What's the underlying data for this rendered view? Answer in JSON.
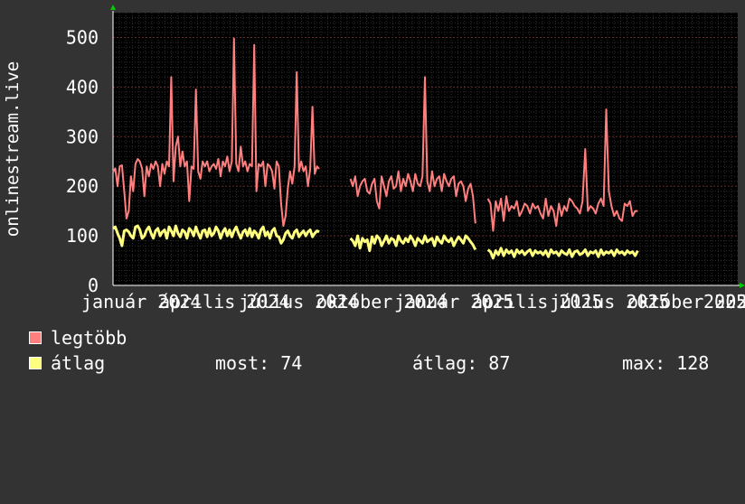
{
  "chart_data": {
    "type": "line",
    "ylabel": "onlinestream.live",
    "ylim": [
      0,
      550
    ],
    "y_ticks": [
      0,
      100,
      200,
      300,
      400,
      500
    ],
    "grid": true,
    "x_tick_labels": [
      "január 2024",
      "április 2024",
      "július 2024",
      "október 2024",
      "január 2025",
      "április 2025",
      "július 2025",
      "október 2025",
      "2025"
    ],
    "series": [
      {
        "name": "legtöbb",
        "color": "#ff7f7f",
        "segments": [
          {
            "x_range": [
              0,
              0.33
            ],
            "values": [
              228,
              236,
              200,
              240,
              242,
              190,
              135,
              150,
              220,
              190,
              245,
              255,
              250,
              235,
              180,
              240,
              220,
              245,
              235,
              250,
              240,
              200,
              245,
              225,
              250,
              240,
              420,
              210,
              280,
              300,
              240,
              270,
              240,
              250,
              170,
              240,
              235,
              395,
              230,
              215,
              250,
              240,
              250,
              230,
              240,
              245,
              235,
              255,
              220,
              250,
              240,
              260,
              230,
              250,
              498,
              245,
              230,
              280,
              240,
              250,
              230,
              245,
              240,
              485,
              190,
              245,
              240,
              250,
              200,
              245,
              240,
              230,
              195,
              250,
              240,
              165,
              120,
              140,
              195,
              230,
              205,
              240,
              430,
              230,
              250,
              230,
              240,
              200,
              235,
              360,
              225,
              240,
              235
            ]
          },
          {
            "x_range": [
              0.38,
              0.58
            ],
            "values": [
              215,
              200,
              220,
              180,
              200,
              210,
              215,
              190,
              185,
              205,
              215,
              170,
              155,
              220,
              200,
              180,
              210,
              220,
              195,
              200,
              230,
              190,
              215,
              200,
              225,
              210,
              190,
              225,
              205,
              200,
              220,
              420,
              210,
              190,
              230,
              200,
              215,
              220,
              190,
              225,
              210,
              200,
              215,
              220,
              180,
              205,
              210,
              200,
              170,
              195,
              205,
              180,
              125
            ]
          },
          {
            "x_range": [
              0.6,
              0.84
            ],
            "values": [
              175,
              165,
              110,
              170,
              150,
              175,
              130,
              180,
              150,
              160,
              155,
              170,
              140,
              150,
              165,
              160,
              145,
              165,
              155,
              160,
              145,
              135,
              175,
              140,
              160,
              150,
              120,
              165,
              140,
              160,
              150,
              175,
              170,
              160,
              155,
              145,
              170,
              275,
              150,
              160,
              155,
              145,
              165,
              175,
              160,
              355,
              190,
              160,
              140,
              150,
              135,
              130,
              165,
              160,
              170,
              140,
              150,
              150
            ]
          }
        ]
      },
      {
        "name": "átlag",
        "color": "#ffff7f",
        "segments": [
          {
            "x_range": [
              0,
              0.33
            ],
            "values": [
              115,
              118,
              105,
              95,
              80,
              110,
              112,
              108,
              100,
              95,
              118,
              120,
              112,
              95,
              100,
              112,
              118,
              105,
              95,
              110,
              115,
              100,
              108,
              112,
              95,
              118,
              110,
              100,
              120,
              105,
              98,
              112,
              108,
              95,
              115,
              110,
              100,
              118,
              105,
              95,
              110,
              112,
              98,
              115,
              100,
              105,
              118,
              110,
              95,
              108,
              115,
              100,
              112,
              98,
              110,
              118,
              105,
              95,
              108,
              112,
              100,
              115,
              98,
              110,
              105,
              95,
              112,
              118,
              100,
              108,
              95,
              110,
              115,
              100,
              98,
              85,
              92,
              105,
              110,
              100,
              95,
              108,
              112,
              98,
              105,
              110,
              100,
              108,
              112,
              98,
              105,
              110,
              108
            ]
          },
          {
            "x_range": [
              0.38,
              0.58
            ],
            "values": [
              95,
              90,
              80,
              100,
              75,
              95,
              88,
              92,
              70,
              98,
              85,
              100,
              95,
              80,
              90,
              100,
              85,
              95,
              92,
              80,
              100,
              90,
              85,
              95,
              88,
              100,
              92,
              80,
              95,
              90,
              85,
              100,
              88,
              92,
              95,
              80,
              98,
              90,
              85,
              100,
              92,
              88,
              95,
              80,
              90,
              98,
              92,
              85,
              100,
              95,
              88,
              82,
              72
            ]
          },
          {
            "x_range": [
              0.6,
              0.84
            ],
            "values": [
              72,
              68,
              55,
              70,
              62,
              75,
              60,
              72,
              65,
              70,
              58,
              72,
              65,
              70,
              62,
              68,
              72,
              60,
              70,
              65,
              68,
              62,
              70,
              58,
              72,
              65,
              68,
              60,
              70,
              65,
              62,
              72,
              58,
              68,
              70,
              62,
              65,
              72,
              60,
              68,
              65,
              70,
              58,
              72,
              62,
              68,
              65,
              70,
              60,
              72,
              65,
              68,
              62,
              70,
              65,
              68,
              60,
              70
            ]
          }
        ]
      }
    ]
  },
  "legend": {
    "max_item": "legtöbb",
    "avg_item": "átlag",
    "now_text": "most: 74",
    "avg_text": "átlag: 87",
    "max_text": "max: 128"
  }
}
